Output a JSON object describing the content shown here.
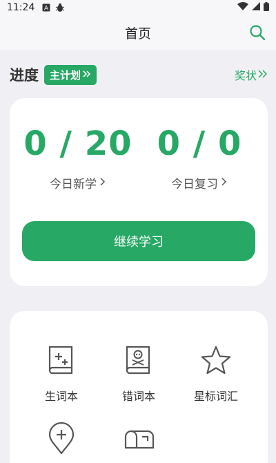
{
  "status_bar": {
    "time": "11:24",
    "icons": [
      "a-badge-icon",
      "bug-icon",
      "wifi-icon",
      "signal-icon",
      "battery-icon"
    ]
  },
  "header": {
    "title": "首页",
    "search_icon": "search-icon"
  },
  "progress": {
    "label": "进度",
    "plan_button": "主计划",
    "reward_link": "奖状"
  },
  "stats": {
    "new": {
      "value": "0 / 20",
      "label": "今日新学"
    },
    "review": {
      "value": "0 / 0",
      "label": "今日复习"
    }
  },
  "continue_button": "继续学习",
  "tools": [
    {
      "label": "生词本",
      "icon": "new-words-book-icon"
    },
    {
      "label": "错词本",
      "icon": "wrong-words-book-icon"
    },
    {
      "label": "星标词汇",
      "icon": "star-icon"
    },
    {
      "label": "",
      "icon": "location-add-icon"
    },
    {
      "label": "",
      "icon": "mailbox-icon"
    }
  ],
  "colors": {
    "accent": "#27a865",
    "background": "#f0f0f4",
    "card": "#ffffff"
  }
}
